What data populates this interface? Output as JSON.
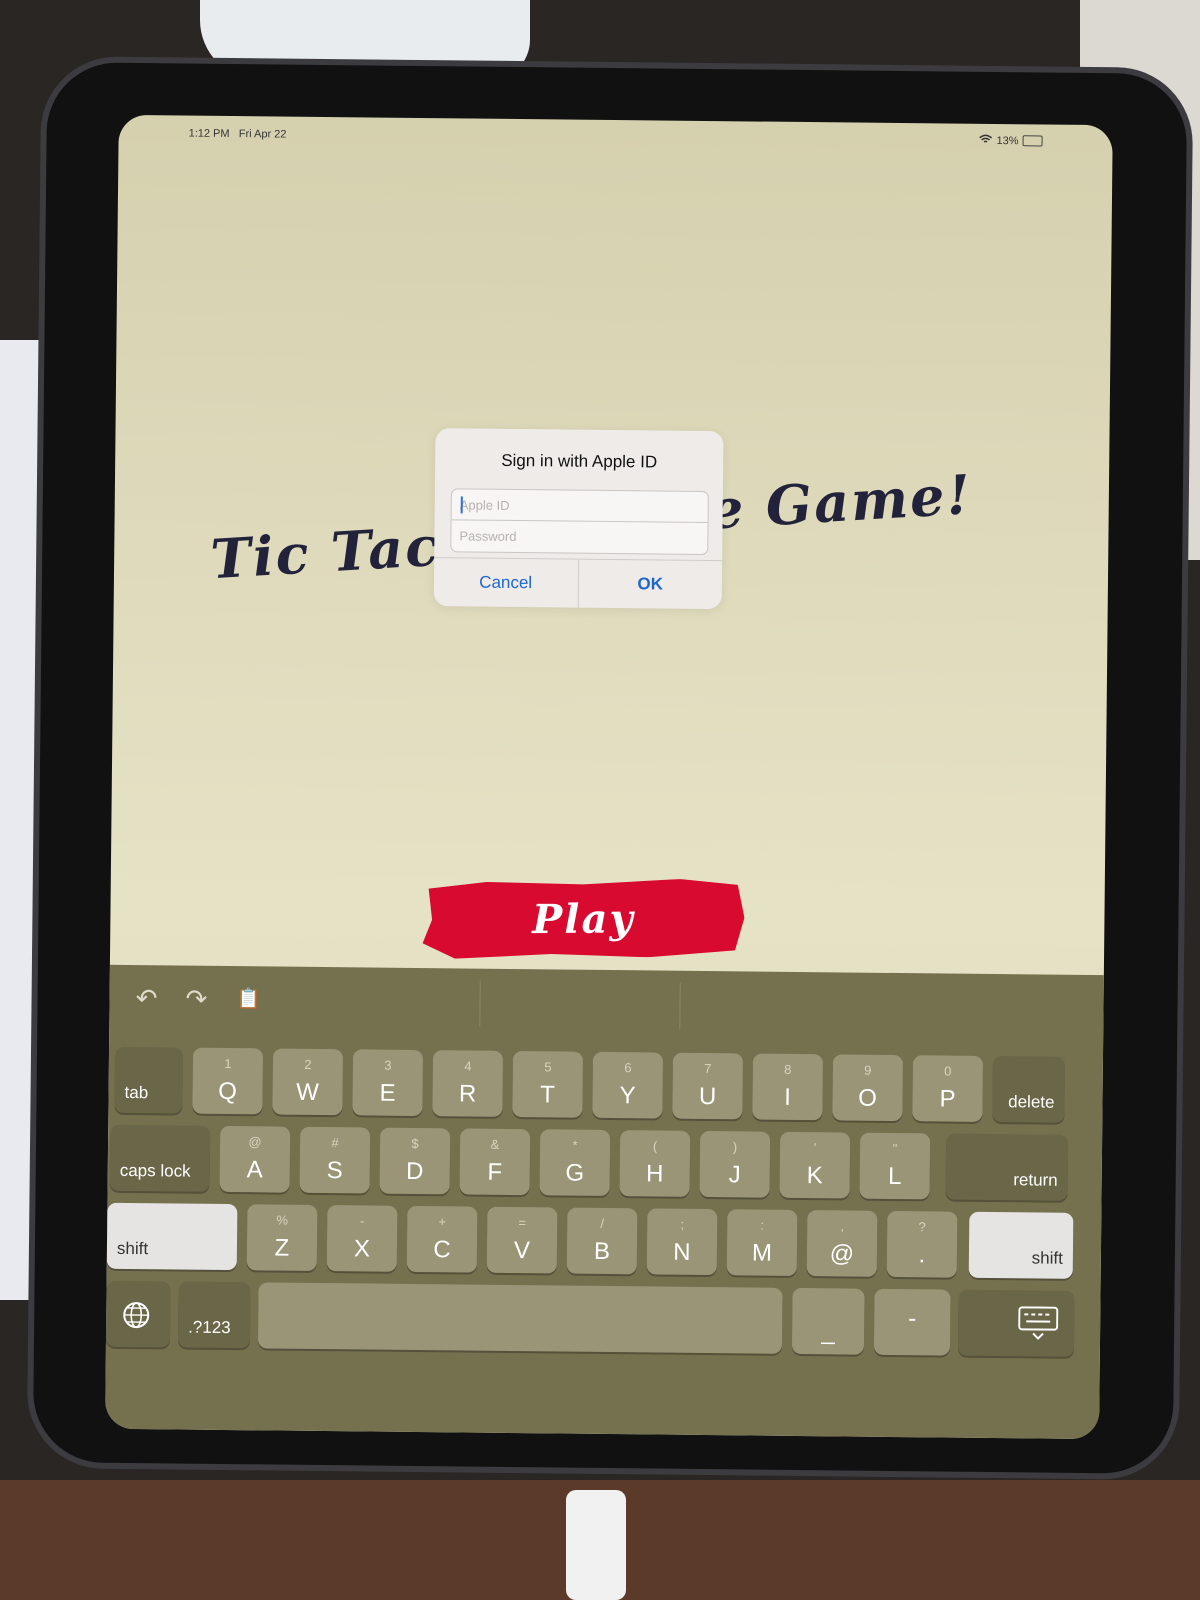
{
  "status": {
    "time": "1:12 PM",
    "date": "Fri Apr 22",
    "battery": "13%"
  },
  "game": {
    "title_left": "Tic Tac",
    "title_right": "e Game!",
    "play": "Play"
  },
  "dialog": {
    "title": "Sign in with Apple ID",
    "apple_id_placeholder": "Apple ID",
    "password_placeholder": "Password",
    "cancel": "Cancel",
    "ok": "OK"
  },
  "keyboard": {
    "toolbar": {
      "undo": "↶",
      "redo": "↷",
      "paste": "📋"
    },
    "row1": [
      {
        "sub": "1",
        "main": "Q"
      },
      {
        "sub": "2",
        "main": "W"
      },
      {
        "sub": "3",
        "main": "E"
      },
      {
        "sub": "4",
        "main": "R"
      },
      {
        "sub": "5",
        "main": "T"
      },
      {
        "sub": "6",
        "main": "Y"
      },
      {
        "sub": "7",
        "main": "U"
      },
      {
        "sub": "8",
        "main": "I"
      },
      {
        "sub": "9",
        "main": "O"
      },
      {
        "sub": "0",
        "main": "P"
      }
    ],
    "row2": [
      {
        "sub": "@",
        "main": "A"
      },
      {
        "sub": "#",
        "main": "S"
      },
      {
        "sub": "$",
        "main": "D"
      },
      {
        "sub": "&",
        "main": "F"
      },
      {
        "sub": "*",
        "main": "G"
      },
      {
        "sub": "(",
        "main": "H"
      },
      {
        "sub": ")",
        "main": "J"
      },
      {
        "sub": "'",
        "main": "K"
      },
      {
        "sub": "\"",
        "main": "L"
      }
    ],
    "row3": [
      {
        "sub": "%",
        "main": "Z"
      },
      {
        "sub": "-",
        "main": "X"
      },
      {
        "sub": "+",
        "main": "C"
      },
      {
        "sub": "=",
        "main": "V"
      },
      {
        "sub": "/",
        "main": "B"
      },
      {
        "sub": ";",
        "main": "N"
      },
      {
        "sub": ":",
        "main": "M"
      },
      {
        "sub": ",",
        "main": "@"
      },
      {
        "sub": "?",
        "main": "."
      }
    ],
    "tab": "tab",
    "delete": "delete",
    "caps_lock": "caps lock",
    "return": "return",
    "shift": "shift",
    "numbers": ".?123",
    "underscore": "_",
    "dash": "-"
  }
}
